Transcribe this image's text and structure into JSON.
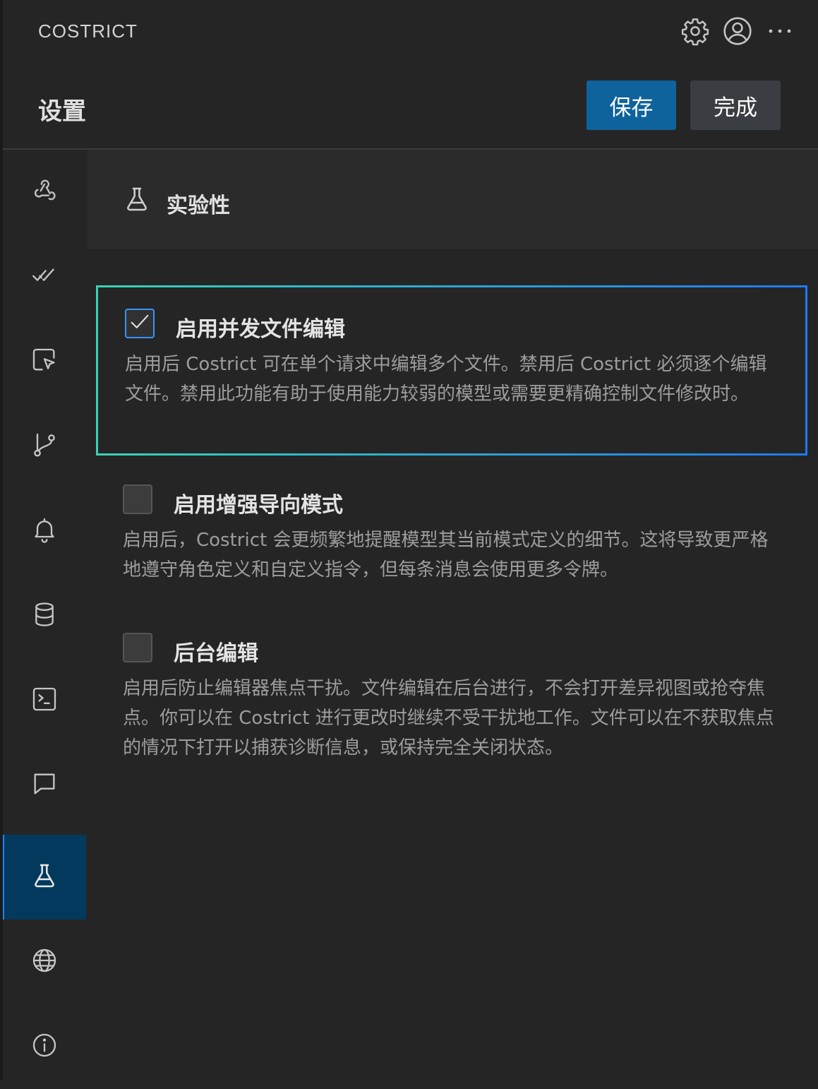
{
  "app": {
    "title": "COSTRICT"
  },
  "title_actions": [
    {
      "name": "settings-gear",
      "icon": "gear-icon"
    },
    {
      "name": "account",
      "icon": "account-icon"
    },
    {
      "name": "more-actions",
      "icon": "ellipsis-icon"
    }
  ],
  "header": {
    "title": "设置",
    "save_label": "保存",
    "done_label": "完成"
  },
  "sidebar": {
    "items": [
      {
        "icon": "webhook-icon",
        "active": false
      },
      {
        "icon": "check-all-icon",
        "active": false
      },
      {
        "icon": "pointer-selection-icon",
        "active": false
      },
      {
        "icon": "git-branch-icon",
        "active": false
      },
      {
        "icon": "bell-icon",
        "active": false
      },
      {
        "icon": "database-icon",
        "active": false
      },
      {
        "icon": "terminal-icon",
        "active": false
      },
      {
        "icon": "chat-icon",
        "active": false
      },
      {
        "icon": "beaker-icon",
        "active": true
      },
      {
        "icon": "globe-icon",
        "active": false
      },
      {
        "icon": "info-icon",
        "active": false
      }
    ]
  },
  "section": {
    "title": "实验性",
    "icon": "beaker-icon"
  },
  "settings": [
    {
      "label": "启用并发文件编辑",
      "checked": true,
      "focused": true,
      "description": "启用后 Costrict 可在单个请求中编辑多个文件。禁用后 Costrict 必须逐个编辑文件。禁用此功能有助于使用能力较弱的模型或需要更精确控制文件修改时。"
    },
    {
      "label": "启用增强导向模式",
      "checked": false,
      "focused": false,
      "description": "启用后，Costrict 会更频繁地提醒模型其当前模式定义的细节。这将导致更严格地遵守角色定义和自定义指令，但每条消息会使用更多令牌。"
    },
    {
      "label": "后台编辑",
      "checked": false,
      "focused": false,
      "description": "启用后防止编辑器焦点干扰。文件编辑在后台进行，不会打开差异视图或抢夺焦点。你可以在 Costrict 进行更改时继续不受干扰地工作。文件可以在不获取焦点的情况下打开以捕获诊断信息，或保持完全关闭状态。"
    }
  ],
  "colors": {
    "background": "#252526",
    "primary_button": "#0e639c",
    "secondary_button": "#3a3d41",
    "active_nav": "#04395e",
    "focus_border": "#2fb1c7",
    "checkbox_checked_border": "#3794ff"
  }
}
